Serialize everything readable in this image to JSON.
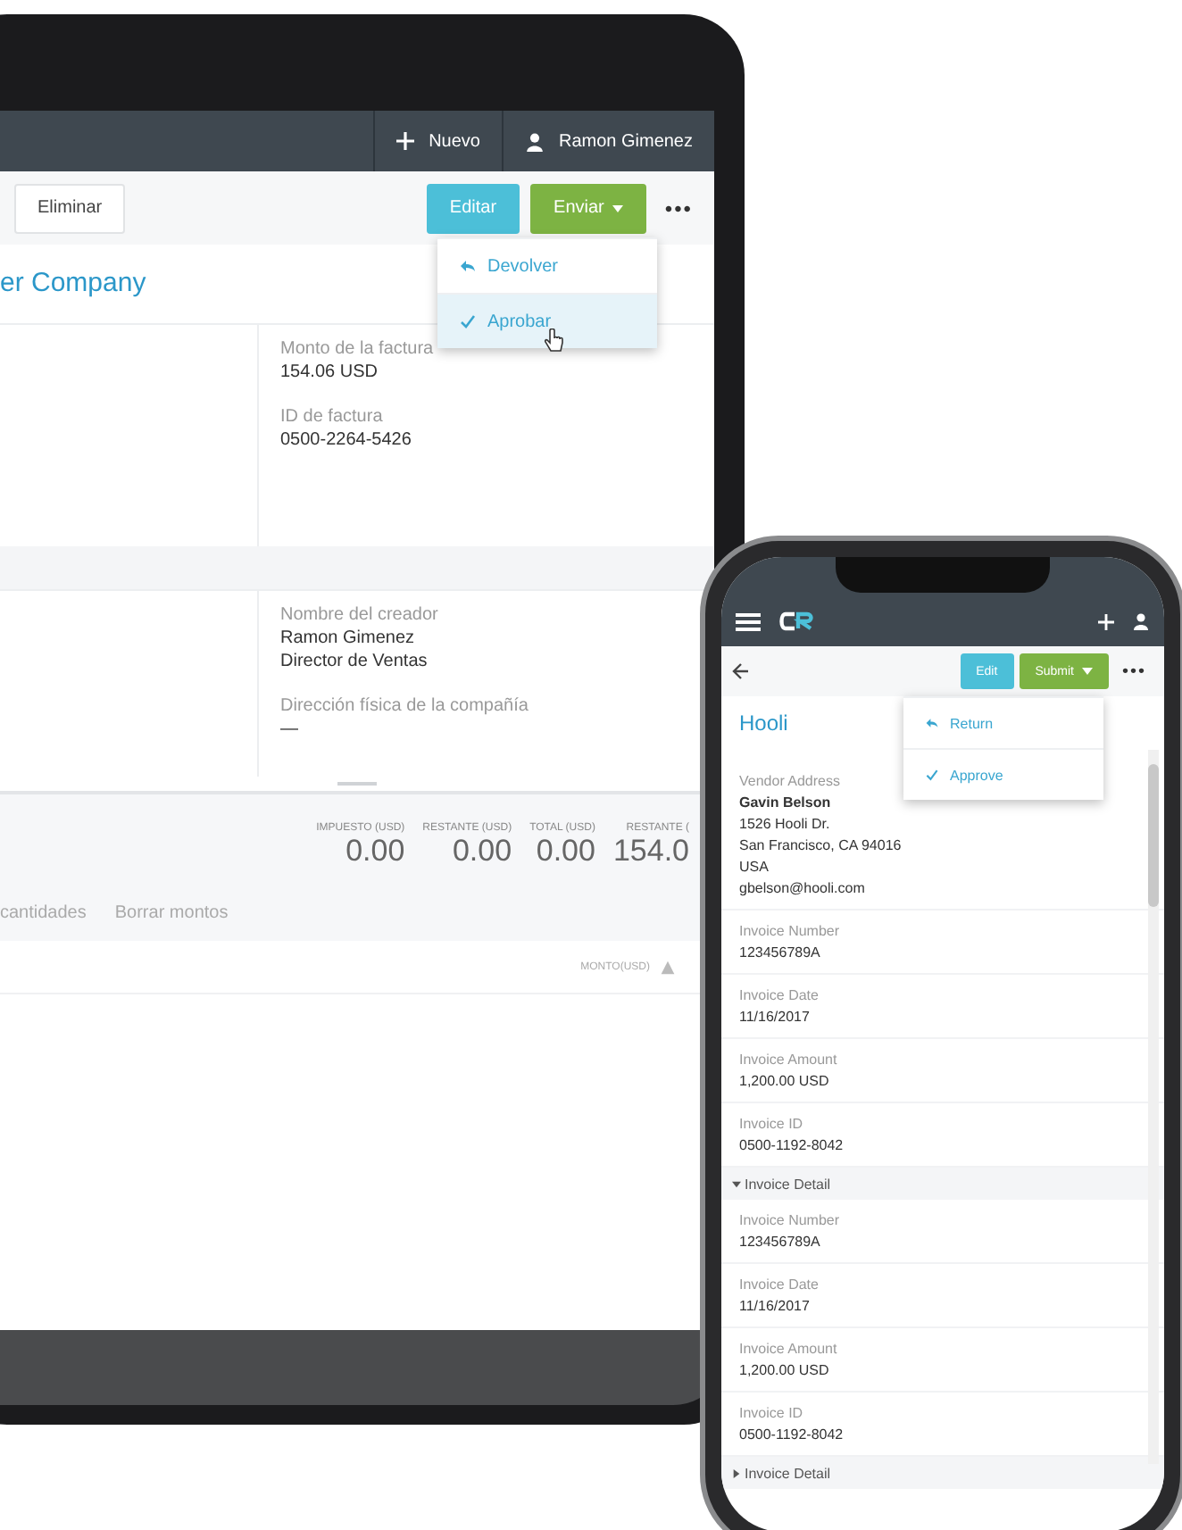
{
  "laptop": {
    "header": {
      "new_label": "Nuevo",
      "user": "Ramon Gimenez"
    },
    "toolbar": {
      "delete": "Eliminar",
      "edit": "Editar",
      "submit": "Enviar",
      "more": "•••"
    },
    "menu": [
      {
        "kind": "return",
        "label": "Devolver",
        "selected": false
      },
      {
        "kind": "approve",
        "label": "Aprobar",
        "selected": true
      }
    ],
    "title": "er Company",
    "section_1": [
      {
        "label": "Monto de la factura",
        "values": [
          "154.06 USD"
        ]
      },
      {
        "label": "ID de factura",
        "values": [
          "0500-2264-5426"
        ]
      }
    ],
    "section_2": [
      {
        "label": "Nombre del creador",
        "values": [
          "Ramon Gimenez",
          "Director de Ventas"
        ]
      },
      {
        "label": "Dirección física de la compañía",
        "values": [
          "—"
        ]
      }
    ],
    "totals": [
      {
        "label": "IMPUESTO (USD)",
        "value": "0.00"
      },
      {
        "label": "RESTANTE (USD)",
        "value": "0.00"
      },
      {
        "label": "TOTAL (USD)",
        "value": "0.00"
      },
      {
        "label": "RESTANTE (",
        "value": "154.0"
      }
    ],
    "actions": [
      "cantidades",
      "Borrar montos"
    ],
    "table_header": "MONTO(USD)"
  },
  "phone": {
    "toolbar": {
      "edit": "Edit",
      "submit": "Submit",
      "more": "•••"
    },
    "menu": [
      {
        "kind": "return",
        "label": "Return",
        "selected": false
      },
      {
        "kind": "approve",
        "label": "Approve",
        "selected": false
      }
    ],
    "title": "Hooli",
    "vendor": {
      "label": "Vendor Address",
      "name": "Gavin Belson",
      "lines": [
        "1526 Hooli Dr.",
        "San Francisco, CA 94016",
        "USA",
        "gbelson@hooli.com"
      ]
    },
    "fields": [
      {
        "label": "Invoice Number",
        "value": "123456789A"
      },
      {
        "label": "Invoice Date",
        "value": "11/16/2017"
      },
      {
        "label": "Invoice Amount",
        "value": "1,200.00 USD"
      },
      {
        "label": "Invoice ID",
        "value": "0500-1192-8042"
      }
    ],
    "sections": [
      {
        "title": "Invoice Detail",
        "expanded": true,
        "fields": [
          {
            "label": "Invoice Number",
            "value": "123456789A"
          },
          {
            "label": "Invoice Date",
            "value": "11/16/2017"
          },
          {
            "label": "Invoice Amount",
            "value": "1,200.00 USD"
          },
          {
            "label": "Invoice ID",
            "value": "0500-1192-8042"
          }
        ]
      },
      {
        "title": "Invoice Detail",
        "expanded": false
      }
    ]
  }
}
